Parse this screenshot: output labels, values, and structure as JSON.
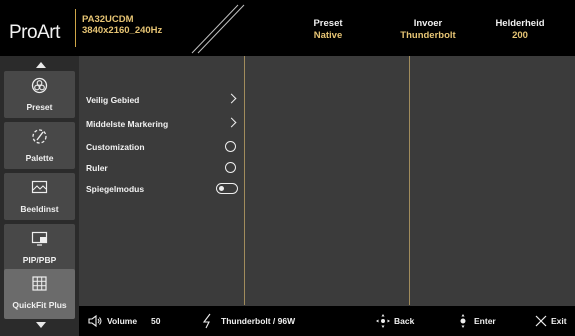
{
  "header": {
    "logo": "ProArt",
    "model": "PA32UCDM",
    "resolution": "3840x2160_240Hz",
    "preset_label": "Preset",
    "preset_value": "Native",
    "input_label": "Invoer",
    "input_value": "Thunderbolt",
    "brightness_label": "Helderheid",
    "brightness_value": "200"
  },
  "sidebar": {
    "items": [
      {
        "label": "Preset",
        "icon": "preset-icon"
      },
      {
        "label": "Palette",
        "icon": "palette-icon"
      },
      {
        "label": "Beeldinst",
        "icon": "image-icon"
      },
      {
        "label": "PIP/PBP",
        "icon": "pip-icon"
      },
      {
        "label": "QuickFit Plus",
        "icon": "grid-icon",
        "active": true
      }
    ]
  },
  "menu": {
    "rows": [
      {
        "label": "Veilig Gebied",
        "control": "chevron"
      },
      {
        "label": "Middelste Markering",
        "control": "chevron"
      },
      {
        "label": "Customization",
        "control": "radio"
      },
      {
        "label": "Ruler",
        "control": "radio"
      },
      {
        "label": "Spiegelmodus",
        "control": "toggle"
      }
    ]
  },
  "footer": {
    "volume_label": "Volume",
    "volume_value": "50",
    "power_text": "Thunderbolt / 96W",
    "back_label": "Back",
    "enter_label": "Enter",
    "exit_label": "Exit"
  },
  "colors": {
    "accent_gold": "#e6c474",
    "divider": "#a18c5c",
    "background": "#3b3b3b"
  }
}
